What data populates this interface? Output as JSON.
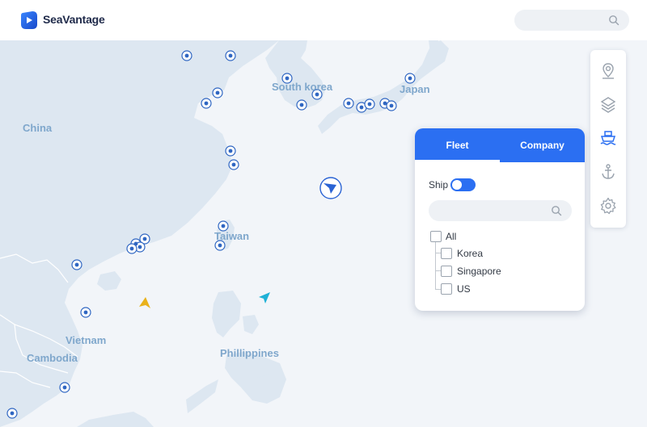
{
  "brand": {
    "name": "SeaVantage"
  },
  "header": {
    "search_placeholder": ""
  },
  "map_labels": {
    "china": "China",
    "south_korea": "South korea",
    "japan": "Japan",
    "taiwan": "Taiwan",
    "vietnam": "Vietnam",
    "cambodia": "Cambodia",
    "philippines": "Phillippines"
  },
  "toolbar": {
    "items": [
      "location-pin-icon",
      "layers-icon",
      "ship-icon",
      "anchor-icon",
      "gear-icon"
    ],
    "active": "ship-icon"
  },
  "panel": {
    "tabs": [
      "Fleet",
      "Company"
    ],
    "active_tab": "Fleet",
    "ship_label": "Ship",
    "ship_toggle": "on",
    "search_placeholder": "",
    "tree": {
      "root": "All",
      "children": [
        "Korea",
        "Singapore",
        "US"
      ]
    }
  },
  "colors": {
    "accent": "#2b6ff2",
    "land": "#dde7f1",
    "sea": "#f2f5f9",
    "port_marker": "#2f66c2",
    "vessel_blue": "#2a63d4",
    "vessel_teal": "#1fb1d6",
    "vessel_yellow": "#e9b21c"
  }
}
